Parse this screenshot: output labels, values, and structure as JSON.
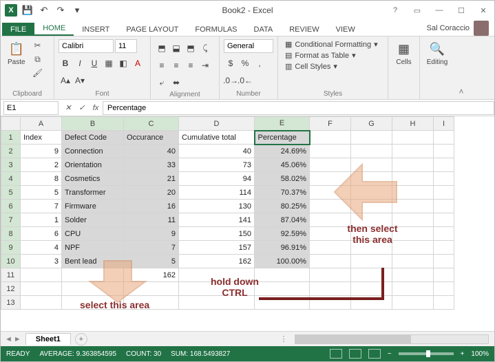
{
  "title": "Book2 - Excel",
  "user": "Sal Coraccio",
  "tabs": {
    "file": "FILE",
    "home": "HOME",
    "insert": "INSERT",
    "page_layout": "PAGE LAYOUT",
    "formulas": "FORMULAS",
    "data": "DATA",
    "review": "REVIEW",
    "view": "VIEW"
  },
  "ribbon": {
    "clipboard": {
      "label": "Clipboard",
      "paste": "Paste"
    },
    "font": {
      "label": "Font",
      "name": "Calibri",
      "size": "11"
    },
    "alignment": {
      "label": "Alignment"
    },
    "number": {
      "label": "Number",
      "format": "General"
    },
    "styles": {
      "label": "Styles",
      "cond": "Conditional Formatting",
      "table": "Format as Table",
      "cell": "Cell Styles"
    },
    "cells": {
      "label": "Cells"
    },
    "editing": {
      "label": "Editing"
    }
  },
  "name_box": "E1",
  "formula": "Percentage",
  "columns": [
    "A",
    "B",
    "C",
    "D",
    "E",
    "F",
    "G",
    "H",
    "I"
  ],
  "headers": {
    "A": "Index",
    "B": "Defect Code",
    "C": "Occurance",
    "D": "Cumulative total",
    "E": "Percentage"
  },
  "rows": [
    {
      "A": "9",
      "B": "Connection",
      "C": "40",
      "D": "40",
      "E": "24.69%"
    },
    {
      "A": "2",
      "B": "Orientation",
      "C": "33",
      "D": "73",
      "E": "45.06%"
    },
    {
      "A": "8",
      "B": "Cosmetics",
      "C": "21",
      "D": "94",
      "E": "58.02%"
    },
    {
      "A": "5",
      "B": "Transformer",
      "C": "20",
      "D": "114",
      "E": "70.37%"
    },
    {
      "A": "7",
      "B": "Firmware",
      "C": "16",
      "D": "130",
      "E": "80.25%"
    },
    {
      "A": "1",
      "B": "Solder",
      "C": "11",
      "D": "141",
      "E": "87.04%"
    },
    {
      "A": "6",
      "B": "CPU",
      "C": "9",
      "D": "150",
      "E": "92.59%"
    },
    {
      "A": "4",
      "B": "NPF",
      "C": "7",
      "D": "157",
      "E": "96.91%"
    },
    {
      "A": "3",
      "B": "Bent lead",
      "C": "5",
      "D": "162",
      "E": "100.00%"
    }
  ],
  "row11_C": "162",
  "sheet": {
    "name": "Sheet1"
  },
  "status": {
    "ready": "READY",
    "avg": "AVERAGE: 9.363854595",
    "count": "COUNT: 30",
    "sum": "SUM: 168.5493827",
    "zoom": "100%"
  },
  "annot": {
    "a1": "select this area",
    "a2": "hold down CTRL",
    "a3": "then select this area"
  },
  "col_widths": {
    "A": 60,
    "B": 90,
    "C": 80,
    "D": 110,
    "E": 80,
    "F": 60,
    "G": 60,
    "H": 60,
    "I": 30
  },
  "chart_data": {
    "type": "table",
    "title": "Defect Pareto data",
    "columns": [
      "Index",
      "Defect Code",
      "Occurance",
      "Cumulative total",
      "Percentage"
    ],
    "rows": [
      [
        9,
        "Connection",
        40,
        40,
        24.69
      ],
      [
        2,
        "Orientation",
        33,
        73,
        45.06
      ],
      [
        8,
        "Cosmetics",
        21,
        94,
        58.02
      ],
      [
        5,
        "Transformer",
        20,
        114,
        70.37
      ],
      [
        7,
        "Firmware",
        16,
        130,
        80.25
      ],
      [
        1,
        "Solder",
        11,
        141,
        87.04
      ],
      [
        6,
        "CPU",
        9,
        150,
        92.59
      ],
      [
        4,
        "NPF",
        7,
        157,
        96.91
      ],
      [
        3,
        "Bent lead",
        5,
        162,
        100.0
      ]
    ],
    "total_occurance": 162
  }
}
